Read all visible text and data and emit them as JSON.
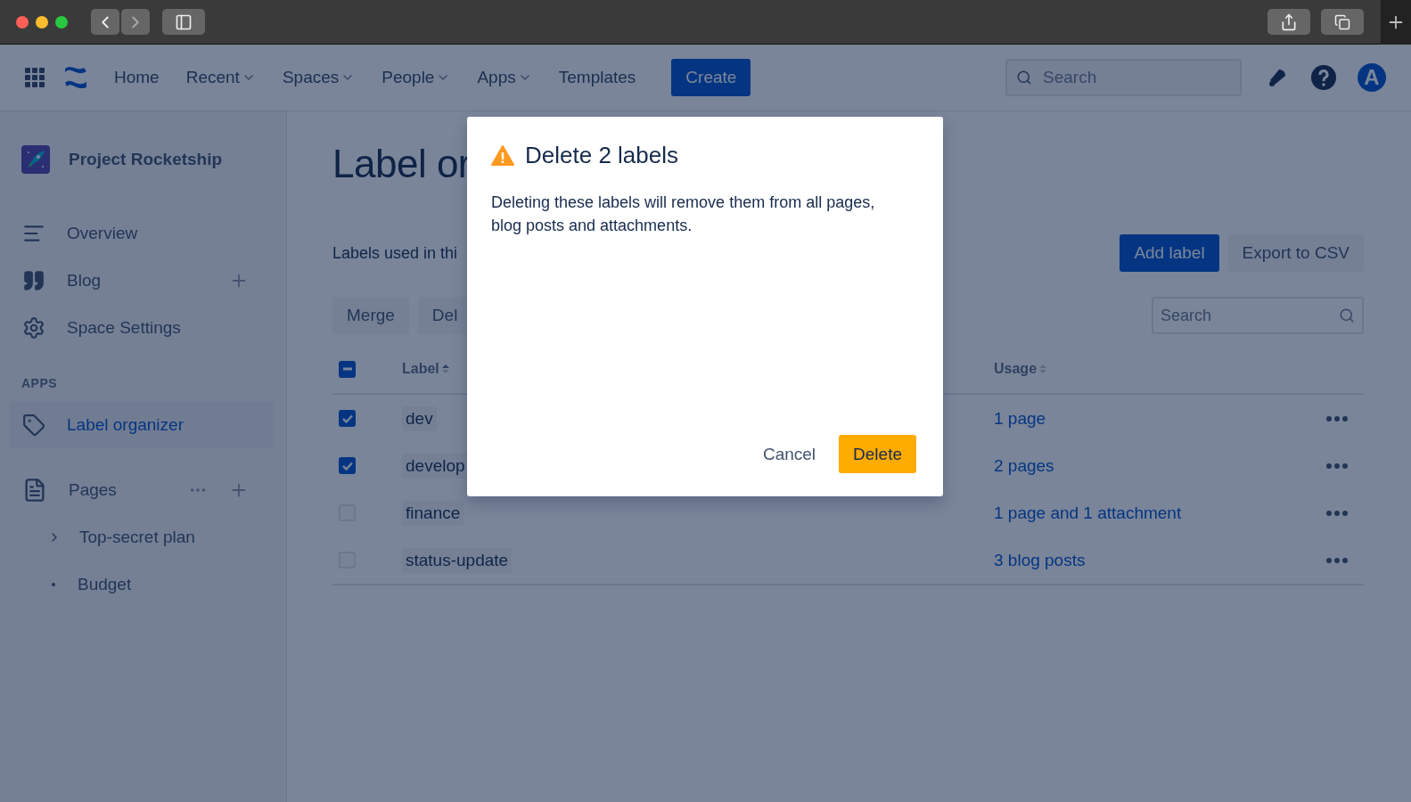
{
  "nav": {
    "items": [
      {
        "label": "Home",
        "dropdown": false
      },
      {
        "label": "Recent",
        "dropdown": true
      },
      {
        "label": "Spaces",
        "dropdown": true
      },
      {
        "label": "People",
        "dropdown": true
      },
      {
        "label": "Apps",
        "dropdown": true
      },
      {
        "label": "Templates",
        "dropdown": false
      }
    ],
    "create": "Create",
    "search": {
      "placeholder": "Search"
    },
    "avatar": "A"
  },
  "sidebar": {
    "space": "Project Rocketship",
    "links": [
      {
        "label": "Overview",
        "kind": "overview",
        "selected": false,
        "add": false
      },
      {
        "label": "Blog",
        "kind": "blog",
        "selected": false,
        "add": true
      },
      {
        "label": "Space Settings",
        "kind": "settings",
        "selected": false,
        "add": false
      }
    ],
    "apps_heading": "APPS",
    "apps": [
      {
        "label": "Label organizer",
        "selected": true
      }
    ],
    "pages": {
      "label": "Pages",
      "children": [
        {
          "label": "Top-secret plan",
          "kind": "parent"
        },
        {
          "label": "Budget",
          "kind": "leaf"
        }
      ]
    }
  },
  "main": {
    "title": "Label or",
    "description": "Labels used in thi",
    "actions": [
      "Merge",
      "Del"
    ],
    "add_label": "Add label",
    "export": "Export to CSV",
    "filter": {
      "placeholder": "Search"
    },
    "table": {
      "select_all_partial": true,
      "columns": [
        {
          "label": "Label",
          "sorted": true
        },
        {
          "label": "Usage",
          "sorted": false
        }
      ],
      "rows": [
        {
          "label": "dev",
          "usage": "1 page",
          "checked": true
        },
        {
          "label": "develop",
          "usage": "2 pages",
          "checked": true
        },
        {
          "label": "finance",
          "usage": "1 page and 1 attachment",
          "checked": false
        },
        {
          "label": "status-update",
          "usage": "3 blog posts",
          "checked": false
        }
      ]
    }
  },
  "modal": {
    "title": "Delete 2 labels",
    "body": "Deleting these labels will remove them from all pages, blog posts and attachments.",
    "cancel": "Cancel",
    "confirm": "Delete"
  }
}
